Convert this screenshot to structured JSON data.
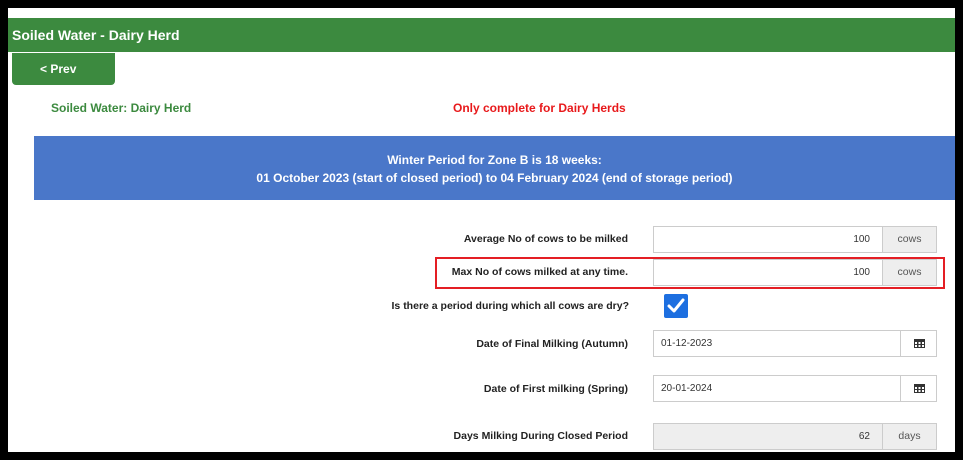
{
  "header": {
    "title": "Soiled Water - Dairy Herd"
  },
  "nav": {
    "prev_label": "< Prev"
  },
  "section": {
    "title": "Soiled Water: Dairy Herd",
    "note": "Only complete for Dairy Herds"
  },
  "banner": {
    "line1": "Winter Period for Zone B is 18 weeks:",
    "line2": "01 October 2023 (start of closed period) to 04 February 2024 (end of storage period)"
  },
  "form": {
    "avg_cows": {
      "label": "Average No of cows to be milked",
      "value": "100",
      "unit": "cows"
    },
    "max_cows": {
      "label": "Max No of cows milked at any time.",
      "value": "100",
      "unit": "cows"
    },
    "dry_period": {
      "label": "Is there a period during which all cows are dry?",
      "checked": true
    },
    "final_milking": {
      "label": "Date of Final Milking (Autumn)",
      "value": "01-12-2023"
    },
    "first_milking": {
      "label": "Date of First milking (Spring)",
      "value": "20-01-2024"
    },
    "days_milking": {
      "label": "Days Milking During Closed Period",
      "value": "62",
      "unit": "days"
    }
  },
  "colors": {
    "header_green": "#3c8a3f",
    "banner_blue": "#4a77c9",
    "note_red": "#e8191b",
    "checkbox_blue": "#1d6fe0"
  }
}
